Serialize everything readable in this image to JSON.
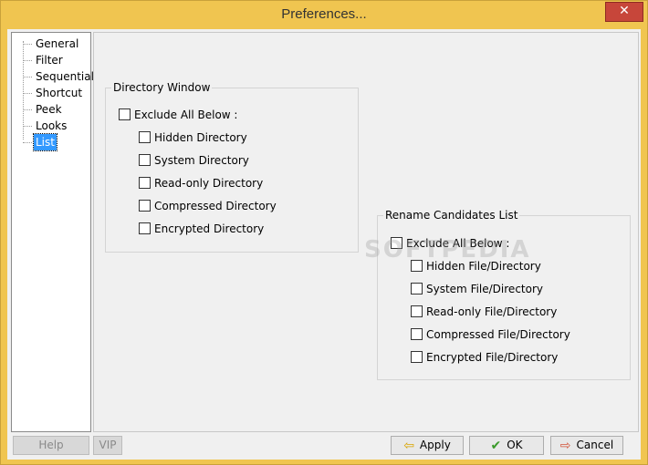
{
  "window": {
    "title": "Preferences...",
    "close_glyph": "✕"
  },
  "tree": {
    "items": [
      {
        "label": "General",
        "selected": false
      },
      {
        "label": "Filter",
        "selected": false
      },
      {
        "label": "Sequential",
        "selected": false
      },
      {
        "label": "Shortcut",
        "selected": false
      },
      {
        "label": "Peek",
        "selected": false
      },
      {
        "label": "Looks",
        "selected": false
      },
      {
        "label": "List",
        "selected": true
      }
    ]
  },
  "directory_window": {
    "title": "Directory Window",
    "exclude_all": "Exclude All Below :",
    "options": [
      "Hidden Directory",
      "System Directory",
      "Read-only Directory",
      "Compressed Directory",
      "Encrypted Directory"
    ]
  },
  "rename_candidates": {
    "title": "Rename Candidates List",
    "exclude_all": "Exclude All Below :",
    "options": [
      "Hidden File/Directory",
      "System File/Directory",
      "Read-only File/Directory",
      "Compressed File/Directory",
      "Encrypted File/Directory"
    ]
  },
  "buttons": {
    "help": "Help",
    "vip": "VIP",
    "apply": "Apply",
    "ok": "OK",
    "cancel": "Cancel"
  },
  "watermark": "SOFTPEDIA",
  "colors": {
    "frame": "#f0c550",
    "close": "#c7463a",
    "selection": "#3399ff"
  }
}
